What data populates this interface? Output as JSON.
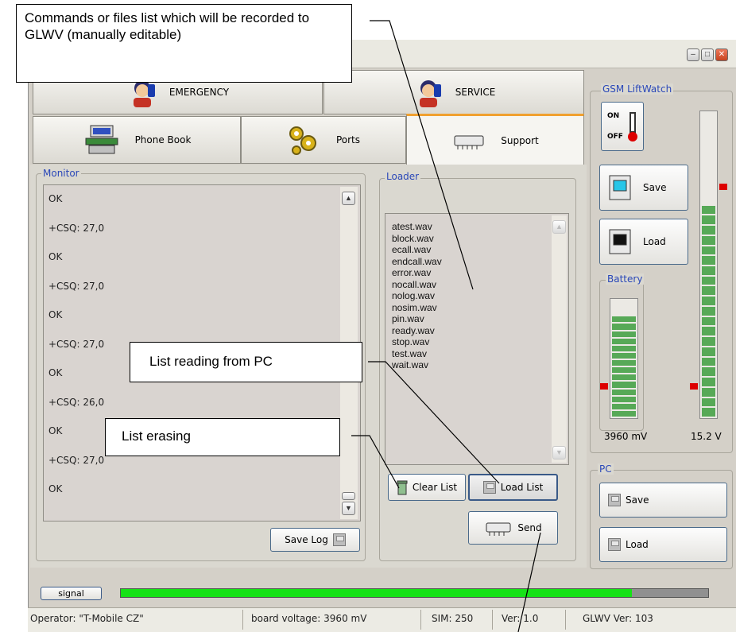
{
  "annotations": {
    "commands": "Commands or files list which will be recorded to GLWV (manually editable)",
    "list_reading": "List reading from PC",
    "list_erasing": "List erasing"
  },
  "top_buttons": {
    "emergency": "EMERGENCY",
    "service": "SERVICE"
  },
  "tabs": [
    {
      "label": "Phone Book",
      "icon": "phone-book-icon"
    },
    {
      "label": "Ports",
      "icon": "gears-icon"
    },
    {
      "label": "Support",
      "icon": "chip-icon",
      "active": true
    }
  ],
  "monitor": {
    "title": "Monitor",
    "lines": [
      "OK",
      "+CSQ: 27,0",
      "OK",
      "+CSQ: 27,0",
      "OK",
      "+CSQ: 27,0",
      "OK",
      "+CSQ: 26,0",
      "OK",
      "+CSQ: 27,0",
      "OK"
    ],
    "save_log": "Save Log"
  },
  "loader": {
    "title": "Loader",
    "files": [
      "atest.wav",
      "block.wav",
      "ecall.wav",
      "endcall.wav",
      "error.wav",
      "nocall.wav",
      "nolog.wav",
      "nosim.wav",
      "pin.wav",
      "ready.wav",
      "stop.wav",
      "test.wav",
      "wait.wav"
    ],
    "clear_list": "Clear List",
    "load_list": "Load List",
    "send": "Send"
  },
  "gsm": {
    "title": "GSM LiftWatch",
    "switch_on": "ON",
    "switch_off": "OFF",
    "save": "Save",
    "load": "Load",
    "battery_title": "Battery",
    "battery_value": "3960 mV",
    "voltage_value": "15.2 V",
    "battery_level": 0.9,
    "voltage_level": 0.7
  },
  "pc": {
    "title": "PC",
    "save": "Save",
    "load": "Load"
  },
  "signal": {
    "label": "signal",
    "level": 0.87
  },
  "status": {
    "operator": "Operator: \"T-Mobile CZ\"",
    "board_voltage": "board voltage: 3960 mV",
    "sim": "SIM: 250",
    "ver": "Ver: 1.0",
    "glwv_ver": "GLWV Ver: 103"
  },
  "colors": {
    "signal_fill": "#16e216",
    "marker": "#dd0000",
    "group_title": "#2a47b8",
    "active_tab": "#f0a030"
  }
}
